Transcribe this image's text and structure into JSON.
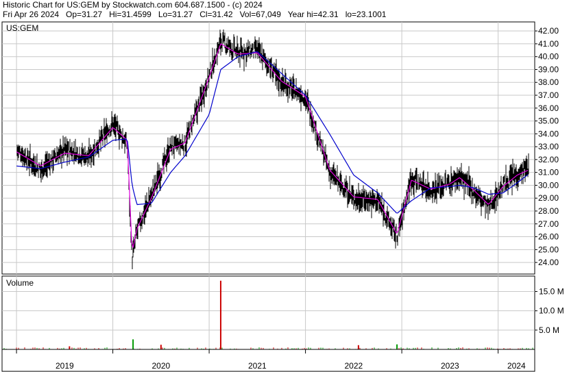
{
  "header": {
    "line1": "Historic Chart for US:GEM by Stockwatch.com 604.687.1500 - (c) 2024",
    "line2": "Fri Apr 26 2024   Op=31.27   Hi=31.4599   Lo=31.27   Cl=31.42   Vol=67,049   Year hi=42.31   lo=23.1001"
  },
  "chart_data": [
    {
      "type": "candlestick",
      "title": "US:GEM",
      "ylim": [
        23.1,
        42.7
      ],
      "yticks": [
        24,
        25,
        26,
        27,
        28,
        29,
        30,
        31,
        32,
        33,
        34,
        35,
        36,
        37,
        38,
        39,
        40,
        41,
        42
      ],
      "ytick_labels": [
        "24.00",
        "25.00",
        "26.00",
        "27.00",
        "28.00",
        "29.00",
        "30.00",
        "31.00",
        "32.00",
        "33.00",
        "34.00",
        "35.00",
        "36.00",
        "37.00",
        "38.00",
        "39.00",
        "40.00",
        "41.00",
        "42.00"
      ],
      "grid": true,
      "colors": {
        "price_bars": "#000000",
        "short_ma": "#e000e0",
        "long_ma": "#0000cc"
      },
      "x": [
        2019.0,
        2019.25,
        2019.5,
        2019.75,
        2020.0,
        2020.15,
        2020.2,
        2020.25,
        2020.4,
        2020.6,
        2020.75,
        2021.0,
        2021.12,
        2021.3,
        2021.5,
        2021.75,
        2022.0,
        2022.25,
        2022.5,
        2022.75,
        2022.95,
        2023.1,
        2023.3,
        2023.5,
        2023.6,
        2023.75,
        2023.9,
        2024.05,
        2024.2,
        2024.32
      ],
      "series": [
        {
          "values": [
            32.8,
            31.2,
            32.8,
            32.2,
            34.8,
            33.2,
            24.2,
            26.5,
            29.2,
            33.0,
            33.2,
            38.5,
            41.2,
            40.3,
            40.5,
            38.0,
            36.8,
            31.0,
            29.0,
            28.8,
            26.0,
            30.6,
            29.6,
            30.2,
            30.7,
            29.5,
            28.3,
            30.0,
            30.9,
            31.4
          ]
        },
        {
          "values": [
            32.6,
            31.5,
            32.5,
            32.3,
            34.5,
            33.5,
            24.8,
            26.6,
            29.0,
            32.8,
            33.3,
            38.4,
            41.0,
            40.2,
            40.3,
            38.1,
            36.9,
            31.2,
            29.1,
            28.9,
            26.2,
            30.4,
            29.7,
            30.1,
            30.6,
            29.6,
            28.5,
            29.9,
            30.8,
            31.2
          ]
        },
        {
          "values": [
            31.5,
            31.3,
            31.8,
            32.2,
            33.5,
            33.6,
            30.0,
            28.5,
            28.6,
            31.0,
            32.3,
            35.5,
            39.0,
            40.0,
            40.4,
            38.7,
            37.0,
            34.0,
            30.8,
            29.4,
            27.8,
            28.8,
            29.8,
            29.9,
            30.0,
            29.8,
            29.3,
            29.4,
            30.2,
            30.9
          ]
        }
      ]
    },
    {
      "type": "bar",
      "title": "Volume",
      "ylim": [
        0,
        19
      ],
      "yticks": [
        5,
        10,
        15
      ],
      "ytick_labels": [
        "5.0 M",
        "10.0 M",
        "15.0 M"
      ],
      "colors": {
        "up": "#009900",
        "down": "#cc0000"
      },
      "x_labels": [
        "2019",
        "2020",
        "2021",
        "2022",
        "2023",
        "2024"
      ],
      "spikes": [
        {
          "x": 2019.55,
          "value": 0.8
        },
        {
          "x": 2020.21,
          "value": 2.6
        },
        {
          "x": 2020.5,
          "value": 1.2
        },
        {
          "x": 2021.12,
          "value": 17.8
        },
        {
          "x": 2022.55,
          "value": 1.1
        },
        {
          "x": 2022.95,
          "value": 1.3
        }
      ]
    }
  ]
}
